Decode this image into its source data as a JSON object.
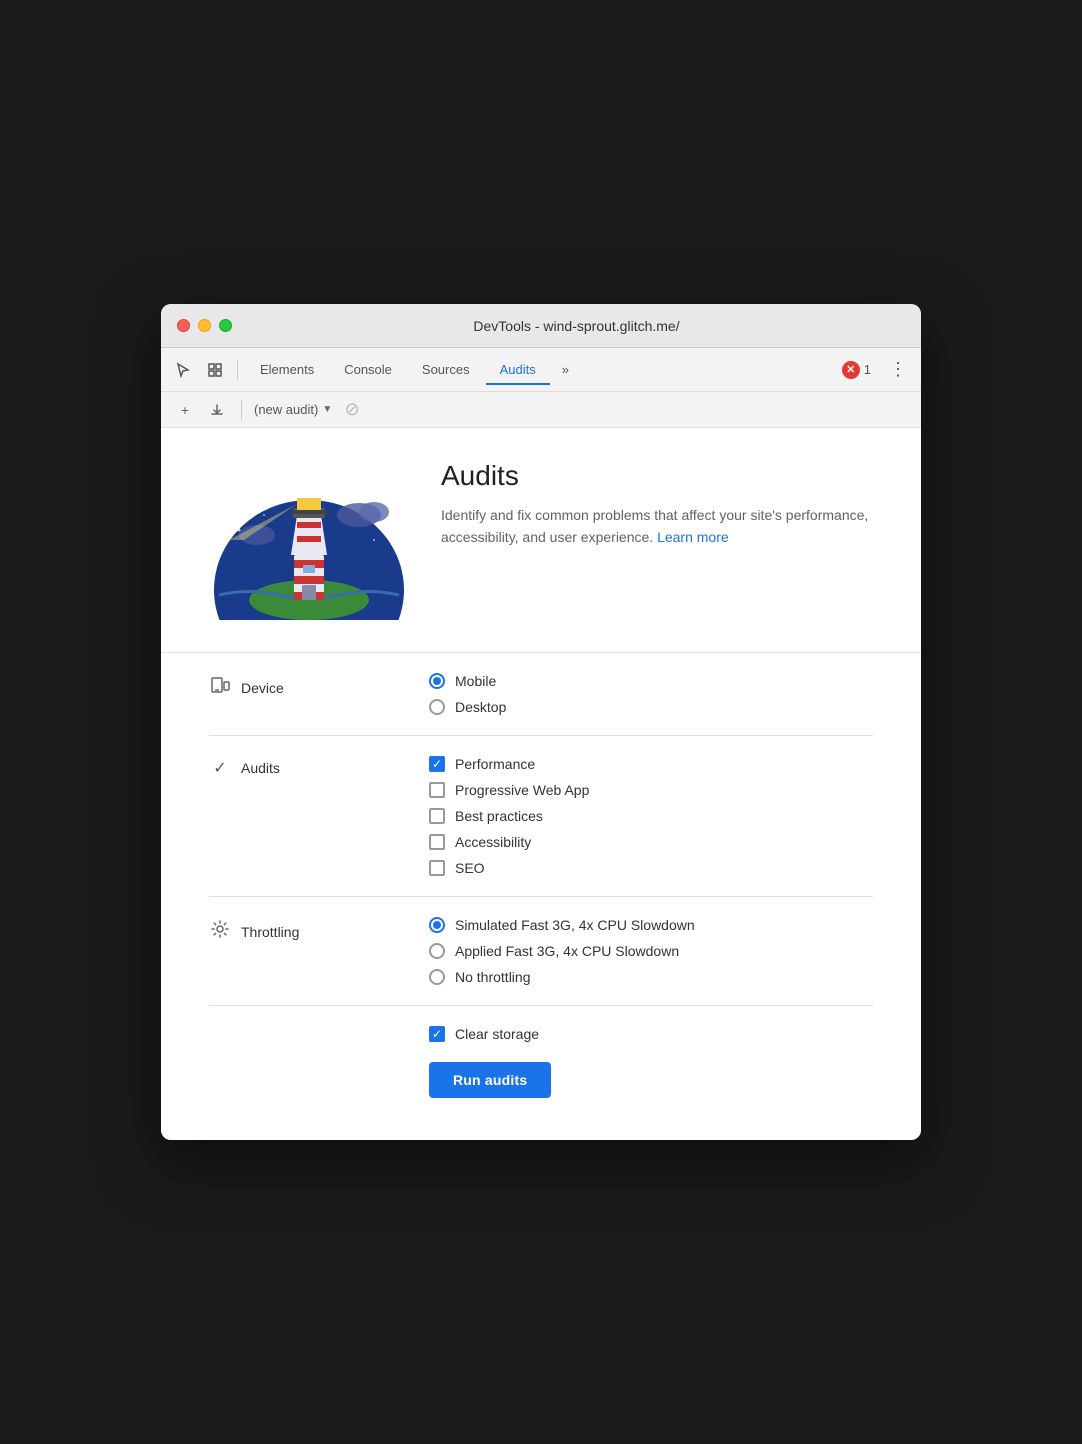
{
  "window": {
    "title": "DevTools - wind-sprout.glitch.me/"
  },
  "titlebar": {
    "dots": [
      "red",
      "yellow",
      "green"
    ]
  },
  "tabs": {
    "items": [
      {
        "label": "Elements",
        "active": false
      },
      {
        "label": "Console",
        "active": false
      },
      {
        "label": "Sources",
        "active": false
      },
      {
        "label": "Audits",
        "active": true
      }
    ],
    "more_label": "»",
    "error_count": "1"
  },
  "sub_toolbar": {
    "new_audit_label": "(new audit)"
  },
  "hero": {
    "title": "Audits",
    "description": "Identify and fix common problems that affect your site's performance, accessibility, and user experience.",
    "learn_more_label": "Learn more"
  },
  "device_section": {
    "label": "Device",
    "options": [
      {
        "label": "Mobile",
        "checked": true
      },
      {
        "label": "Desktop",
        "checked": false
      }
    ]
  },
  "audits_section": {
    "label": "Audits",
    "options": [
      {
        "label": "Performance",
        "checked": true
      },
      {
        "label": "Progressive Web App",
        "checked": false
      },
      {
        "label": "Best practices",
        "checked": false
      },
      {
        "label": "Accessibility",
        "checked": false
      },
      {
        "label": "SEO",
        "checked": false
      }
    ]
  },
  "throttling_section": {
    "label": "Throttling",
    "options": [
      {
        "label": "Simulated Fast 3G, 4x CPU Slowdown",
        "checked": true
      },
      {
        "label": "Applied Fast 3G, 4x CPU Slowdown",
        "checked": false
      },
      {
        "label": "No throttling",
        "checked": false
      }
    ]
  },
  "bottom_section": {
    "clear_storage_label": "Clear storage",
    "clear_storage_checked": true,
    "run_button_label": "Run audits"
  }
}
